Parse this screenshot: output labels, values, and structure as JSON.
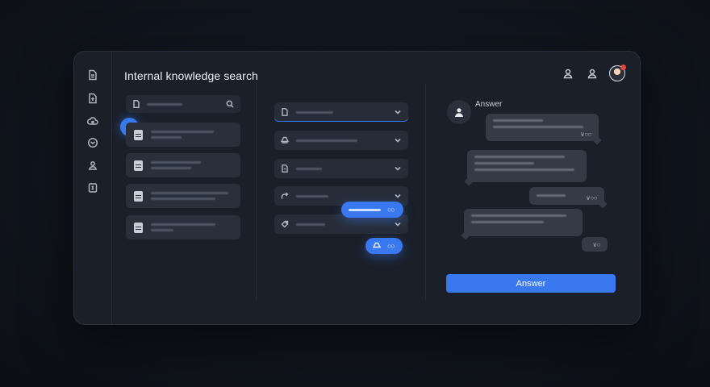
{
  "app": {
    "title": "Internal knowledge search"
  },
  "rail": {
    "items": [
      {
        "icon": "document-icon"
      },
      {
        "icon": "file-upload-icon"
      },
      {
        "icon": "cloud-icon"
      },
      {
        "icon": "mail-icon"
      },
      {
        "icon": "users-icon"
      },
      {
        "icon": "ledger-icon"
      }
    ]
  },
  "header": {
    "actions": [
      {
        "icon": "user-icon"
      },
      {
        "icon": "account-icon"
      }
    ],
    "avatar": {
      "notification": true
    }
  },
  "chat": {
    "assistant_label": "Answer",
    "submit_label": "Answer"
  },
  "colors": {
    "accent": "#3a78ef",
    "window": "#1a1f29",
    "card": "#2a303b",
    "bubble": "#343a46",
    "notification": "#e2463d"
  }
}
